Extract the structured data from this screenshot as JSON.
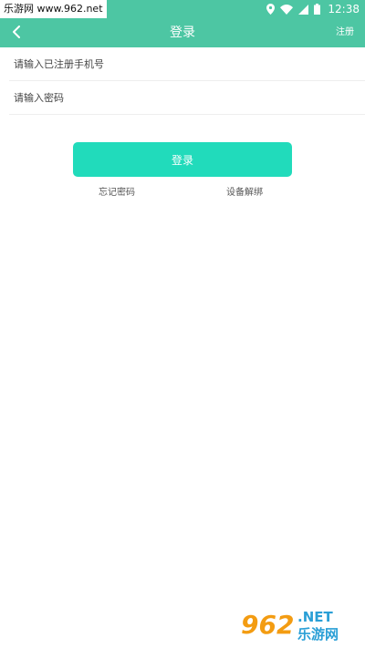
{
  "status_bar": {
    "site_watermark": "乐游网 www.962.net",
    "time": "12:38",
    "icons": [
      "location-icon",
      "wifi-icon",
      "signal-icon",
      "battery-icon"
    ]
  },
  "header": {
    "title": "登录",
    "register_label": "注册",
    "back_icon": "chevron-left-icon"
  },
  "form": {
    "phone_placeholder": "请输入已注册手机号",
    "password_placeholder": "请输入密码",
    "phone_value": "",
    "password_value": ""
  },
  "actions": {
    "login_label": "登录",
    "forgot_password_label": "忘记密码",
    "device_unbind_label": "设备解绑"
  },
  "watermark_logo": {
    "number": "962",
    "suffix": ".NET",
    "chinese": "乐游网"
  },
  "colors": {
    "header_bg": "#4dc6a3",
    "button_bg": "#21dbbb",
    "text": "#444444"
  }
}
